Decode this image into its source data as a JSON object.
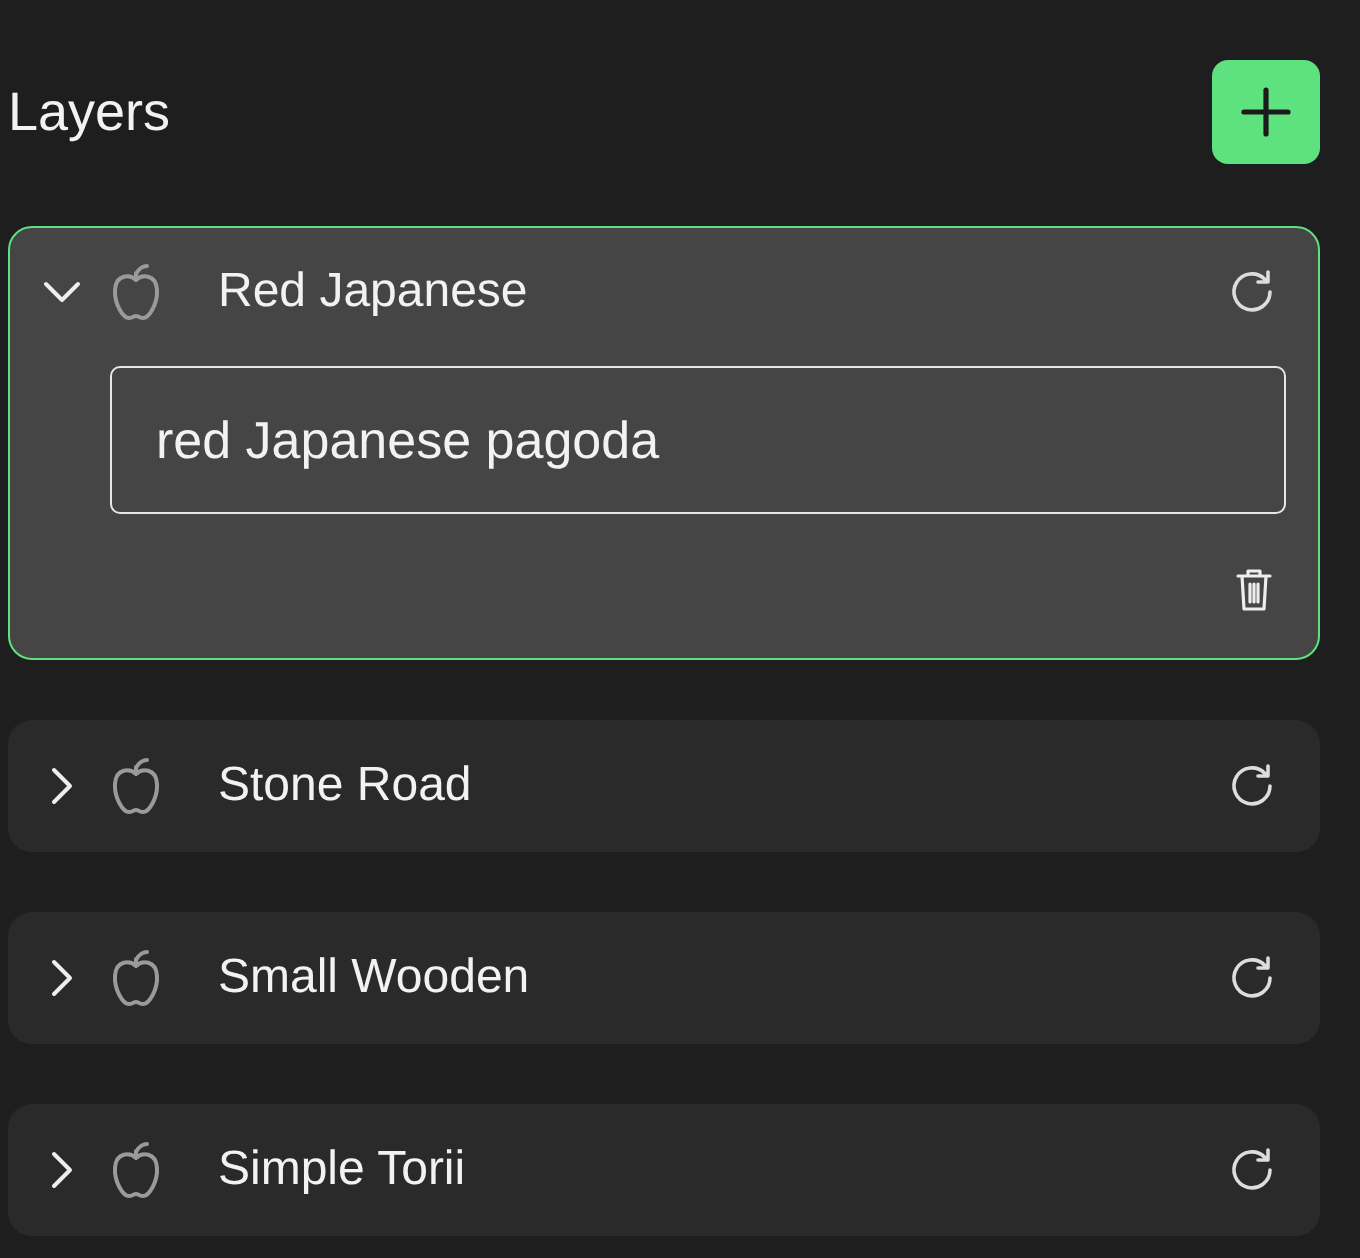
{
  "title": "Layers",
  "layers": [
    {
      "name": "Red Japanese",
      "expanded": true,
      "selected": true,
      "prompt": "red Japanese pagoda"
    },
    {
      "name": "Stone Road",
      "expanded": false,
      "selected": false
    },
    {
      "name": "Small Wooden",
      "expanded": false,
      "selected": false
    },
    {
      "name": "Simple Torii",
      "expanded": false,
      "selected": false
    }
  ]
}
